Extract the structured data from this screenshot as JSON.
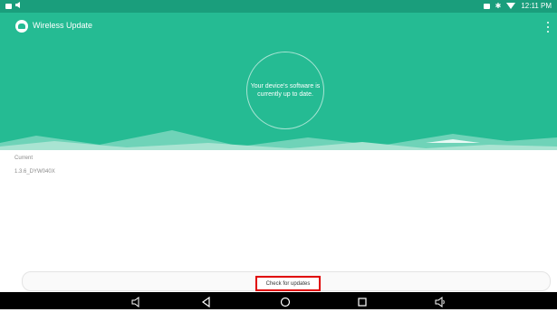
{
  "status_bar": {
    "time": "12:11 PM",
    "icons": [
      "notification-icon",
      "sound-icon",
      "battery-icon",
      "bluetooth-icon",
      "wifi-icon"
    ]
  },
  "app_bar": {
    "title": "Wireless Update",
    "logo_icon": "wireless-update-logo",
    "menu_icon": "overflow-menu-icon"
  },
  "hero": {
    "status_text": "Your device's software is currently up to date."
  },
  "software": {
    "label": "Current",
    "version": "1.3.6_DYW040X"
  },
  "actions": {
    "check_label": "Check for updates"
  },
  "nav_bar": {
    "icons": [
      "volume-down-icon",
      "back-icon",
      "home-icon",
      "recents-icon",
      "volume-up-icon"
    ]
  },
  "colors": {
    "primary": "#25bb93",
    "status_bar": "#1a9e7c",
    "highlight": "#e00000"
  }
}
